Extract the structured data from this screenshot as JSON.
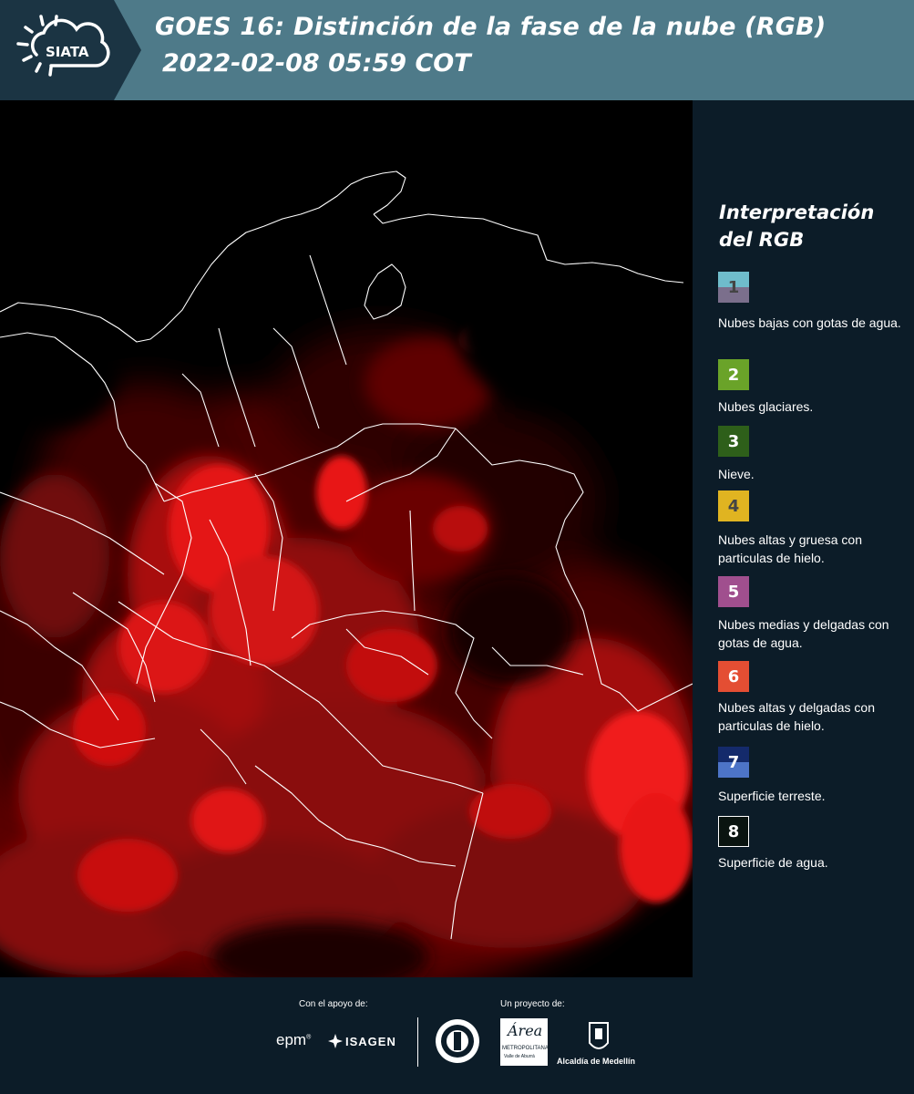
{
  "header": {
    "logo_text": "SIATA",
    "title_line1": "GOES 16: Distinción de la fase de la nube (RGB)",
    "title_line2": "2022-02-08 05:59 COT"
  },
  "legend": {
    "title_line1": "Interpretación",
    "title_line2": "del RGB",
    "items": [
      {
        "num": "1",
        "label": "Nubes bajas con gotas de agua.",
        "color_top": "#6fbccb",
        "color_bottom": "#7b6f8c",
        "num_color": "#444444"
      },
      {
        "num": "2",
        "label": "Nubes glaciares.",
        "color_top": "#6aa329",
        "color_bottom": "#6aa329",
        "num_color": "#ffffff"
      },
      {
        "num": "3",
        "label": "Nieve.",
        "color_top": "#2e5f1a",
        "color_bottom": "#2e5f1a",
        "num_color": "#ffffff"
      },
      {
        "num": "4",
        "label": "Nubes altas y gruesa con particulas de hielo.",
        "color_top": "#e0b421",
        "color_bottom": "#e0b421",
        "num_color": "#444444"
      },
      {
        "num": "5",
        "label": "Nubes medias y delgadas con gotas de agua.",
        "color_top": "#a04f8e",
        "color_bottom": "#a04f8e",
        "num_color": "#ffffff"
      },
      {
        "num": "6",
        "label": "Nubes altas y delgadas con particulas de hielo.",
        "color_top": "#e44e33",
        "color_bottom": "#e44e33",
        "num_color": "#ffffff"
      },
      {
        "num": "7",
        "label": "Superficie terreste.",
        "color_top": "#142a6b",
        "color_bottom": "#4d74c7",
        "num_color": "#ffffff"
      },
      {
        "num": "8",
        "label": "Superficie de agua.",
        "color_top": "#0a1410",
        "color_bottom": "#0a1410",
        "num_color": "#ffffff"
      }
    ]
  },
  "footer": {
    "support_caption": "Con el apoyo de:",
    "project_caption": "Un proyecto de:",
    "sponsor1": "epm",
    "sponsor2": "ISAGEN",
    "partner_area": "Área",
    "partner_area_sub": "METROPOLITANA",
    "partner_area_sub2": "Valle de Aburrá",
    "partner_alcaldia": "Alcaldía de Medellín"
  },
  "colors": {
    "header_bg": "#4e7a89",
    "panel_bg": "#0c1c28",
    "map_cloud": "#e41010",
    "border_line": "#ffffff"
  }
}
